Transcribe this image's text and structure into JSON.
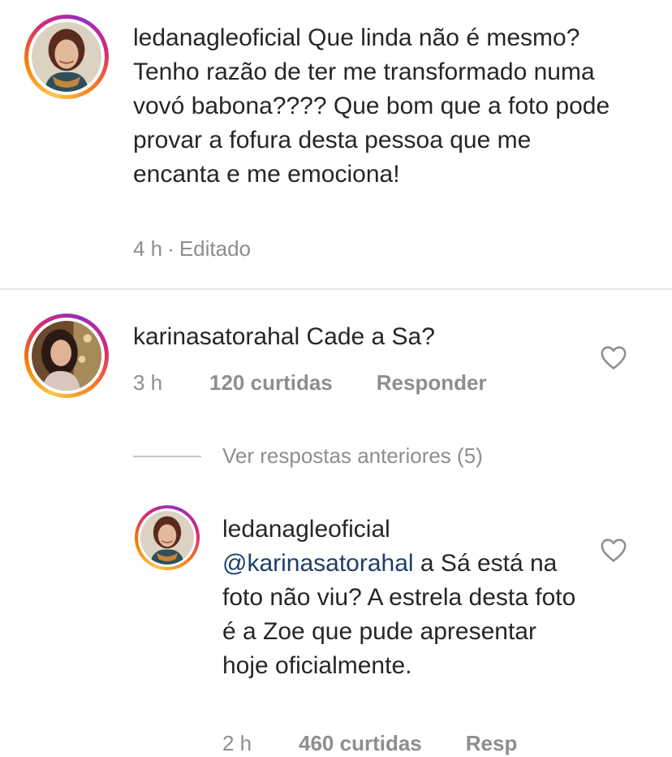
{
  "comments": [
    {
      "username": "ledanagleoficial",
      "text": "Que linda não é mesmo? Tenho razão de ter me transformado  numa vovó babona???? Que bom que a foto pode provar a fofura desta pessoa que me encanta e me emociona!",
      "time": "4 h",
      "separator": "·",
      "edited": "Editado"
    },
    {
      "username": "karinasatorahal",
      "text": "Cade a Sa?",
      "time": "3 h",
      "likes": "120 curtidas",
      "reply": "Responder"
    }
  ],
  "view_previous": "Ver respostas anteriores (5)",
  "reply": {
    "username": "ledanagleoficial",
    "mention": "@karinasatorahal",
    "text": " a Sá está na foto não viu? A estrela desta foto é a Zoe que pude apresentar hoje oficialmente.",
    "time": "2 h",
    "likes": "460 curtidas",
    "reply": "Resp"
  },
  "icons": {
    "like": "heart-icon"
  },
  "colors": {
    "text": "#262626",
    "meta": "#8e8e8e",
    "mention": "#1e3f66",
    "story_ring": [
      "#f9c74f",
      "#d62976",
      "#962fbf"
    ]
  }
}
